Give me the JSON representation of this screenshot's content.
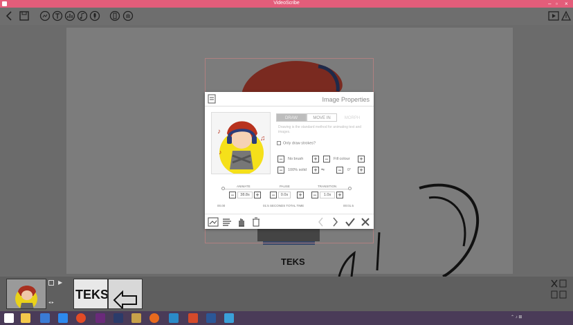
{
  "window": {
    "title": "VideoScribe"
  },
  "toolbar": {
    "left_buttons": [
      "back-icon",
      "save-icon",
      "image-icon",
      "text-icon",
      "chart-icon",
      "music-icon",
      "voice-icon",
      "settings-icon",
      "hand-icon"
    ],
    "right_buttons": [
      "play-icon",
      "upload-icon"
    ]
  },
  "canvas": {
    "caption": "TEKS"
  },
  "dialog": {
    "title": "Image Properties",
    "tabs": [
      "DRAW",
      "MOVE IN",
      "MORPH"
    ],
    "active_tab": "DRAW",
    "hint": "Drawing is the standard method for animating text and images.",
    "only_draw_strokes_label": "Only draw strokes?",
    "brush_label": "No brush",
    "fill_label": "Fill colour",
    "opacity_label": "100% solid",
    "angle_label": "0°",
    "animate": {
      "label": "ANIMATE",
      "value": "38.8s"
    },
    "pause": {
      "label": "PAUSE",
      "value": "0.0s"
    },
    "transition": {
      "label": "TRANSITION",
      "value": "1.0s"
    },
    "timeline_start": "00.00",
    "timeline_total": "01:5 SECONDS TOTAL TIME",
    "timeline_end": "00:01.5"
  },
  "timeline": {
    "clip_text_label": "TEKS"
  },
  "colors": {
    "titlebar": "#e35d7a",
    "taskbar": "#4a3b58"
  }
}
